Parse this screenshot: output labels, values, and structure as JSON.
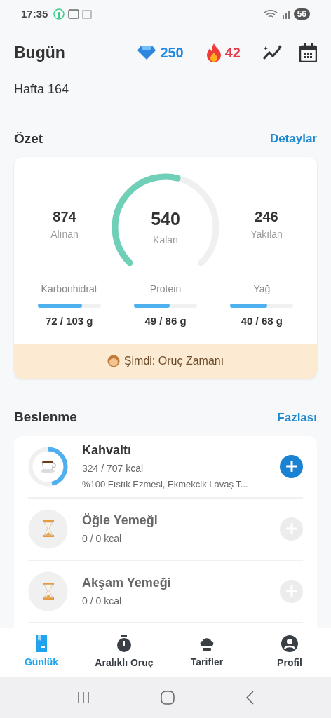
{
  "status_bar": {
    "time": "17:35",
    "battery": "56"
  },
  "header": {
    "title": "Bugün",
    "gems": "250",
    "streak": "42",
    "subtitle": "Hafta 164"
  },
  "summary": {
    "title": "Özet",
    "link": "Detaylar",
    "eaten": {
      "value": "874",
      "label": "Alınan"
    },
    "remaining": {
      "value": "540",
      "label": "Kalan"
    },
    "burned": {
      "value": "246",
      "label": "Yakılan"
    },
    "macros": [
      {
        "name": "Karbonhidrat",
        "level": 0.7,
        "amount": "72 / 103 g"
      },
      {
        "name": "Protein",
        "level": 0.57,
        "amount": "49 / 86 g"
      },
      {
        "name": "Yağ",
        "level": 0.59,
        "amount": "40 / 68 g"
      }
    ],
    "banner": "Şimdi: Oruç Zamanı"
  },
  "nutrition": {
    "title": "Beslenme",
    "link": "Fazlası",
    "meals": [
      {
        "name": "Kahvaltı",
        "kcal": "324 / 707 kcal",
        "foods": "%100 Fıstık Ezmesi, Ekmekcik Lavaş T...",
        "active": true
      },
      {
        "name": "Öğle Yemeği",
        "kcal": "0 / 0 kcal",
        "active": false
      },
      {
        "name": "Akşam Yemeği",
        "kcal": "0 / 0 kcal",
        "active": false
      }
    ]
  },
  "tabs": [
    {
      "label": "Günlük",
      "selected": true
    },
    {
      "label": "Aralıklı Oruç",
      "selected": false
    },
    {
      "label": "Tarifler",
      "selected": false
    },
    {
      "label": "Profil",
      "selected": false
    }
  ]
}
